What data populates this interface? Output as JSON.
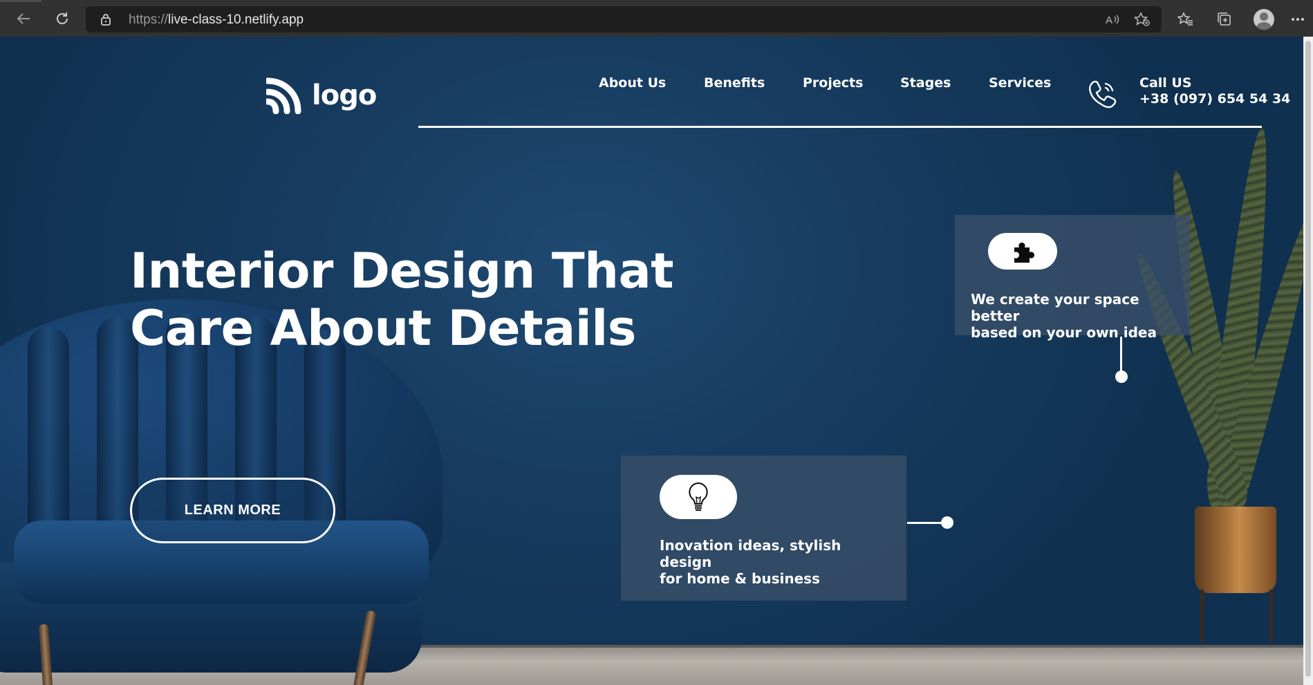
{
  "browser": {
    "url_scheme": "https://",
    "url_host": "live-class-10.netlify.app",
    "icons": [
      "back-icon",
      "refresh-icon",
      "lock-icon",
      "read-aloud-icon",
      "add-favorite-icon",
      "favorites-icon",
      "collections-icon",
      "profile-avatar",
      "more-icon"
    ]
  },
  "header": {
    "logo_text": "logo",
    "nav": [
      "About Us",
      "Benefits",
      "Projects",
      "Stages",
      "Services"
    ],
    "call_label": "Call US",
    "call_number": "+38 (097) 654 54 34"
  },
  "hero": {
    "headline_line1": "Interior Design That",
    "headline_line2": "Care About Details",
    "cta_label": "LEARN MORE"
  },
  "cards": [
    {
      "icon": "puzzle-icon",
      "line1": "We create your space better",
      "line2": "based on your own idea"
    },
    {
      "icon": "lightbulb-icon",
      "line1": "Inovation ideas, stylish",
      "line2": "design",
      "line3": "for home & business"
    }
  ],
  "colors": {
    "background": "#173c60",
    "card": "#3a5069",
    "text": "#ffffff",
    "browser_bar": "#323232"
  }
}
